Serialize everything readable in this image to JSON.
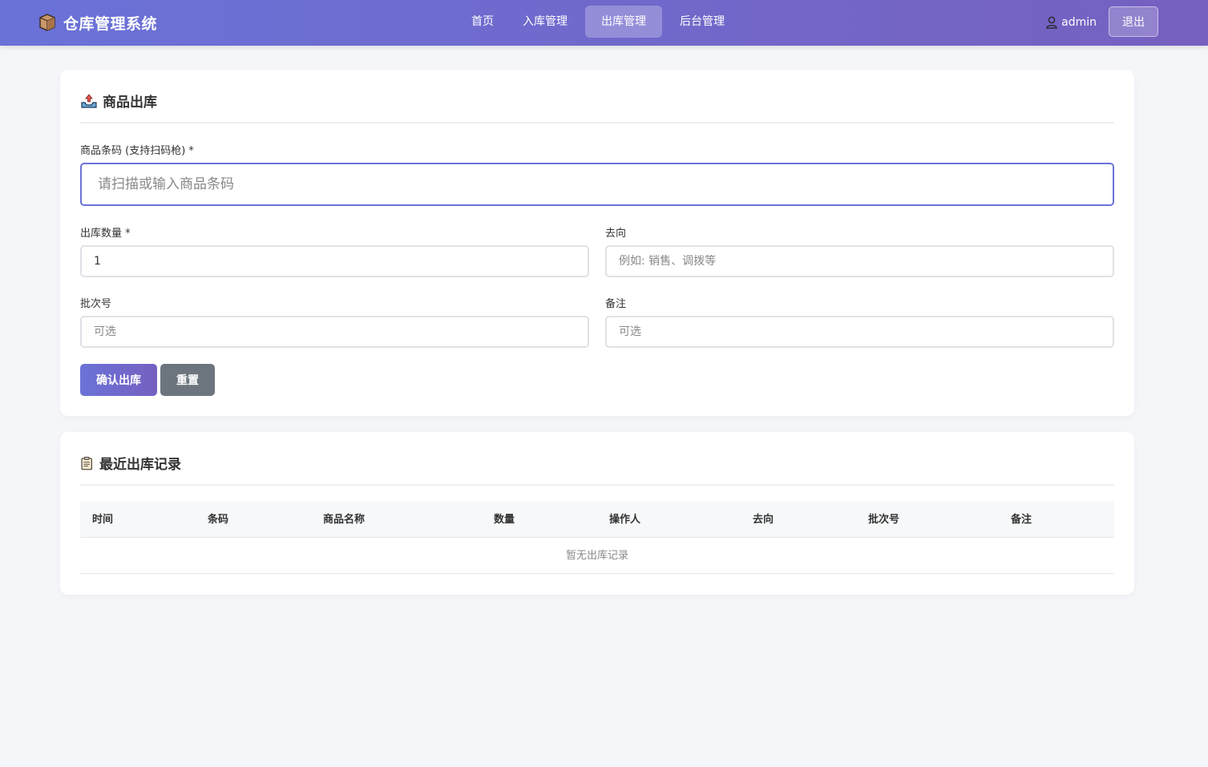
{
  "app": {
    "title": "仓库管理系统"
  },
  "nav": {
    "items": [
      {
        "label": "首页"
      },
      {
        "label": "入库管理"
      },
      {
        "label": "出库管理",
        "active": true
      },
      {
        "label": "后台管理"
      }
    ]
  },
  "user": {
    "name": "admin",
    "logout_label": "退出"
  },
  "outbound": {
    "title": "商品出库",
    "barcode": {
      "label": "商品条码 (支持扫码枪) *",
      "placeholder": "请扫描或输入商品条码",
      "value": ""
    },
    "quantity": {
      "label": "出库数量 *",
      "value": "1"
    },
    "destination": {
      "label": "去向",
      "placeholder": "例如: 销售、调拨等",
      "value": ""
    },
    "batch": {
      "label": "批次号",
      "placeholder": "可选",
      "value": ""
    },
    "remark": {
      "label": "备注",
      "placeholder": "可选",
      "value": ""
    },
    "confirm_label": "确认出库",
    "reset_label": "重置"
  },
  "records": {
    "title": "最近出库记录",
    "columns": [
      "时间",
      "条码",
      "商品名称",
      "数量",
      "操作人",
      "去向",
      "批次号",
      "备注"
    ],
    "empty_text": "暂无出库记录"
  },
  "colors": {
    "accent": "#6a72d8",
    "accent_end": "#7660c0",
    "secondary": "#6c757d",
    "background": "#f5f6fa"
  }
}
